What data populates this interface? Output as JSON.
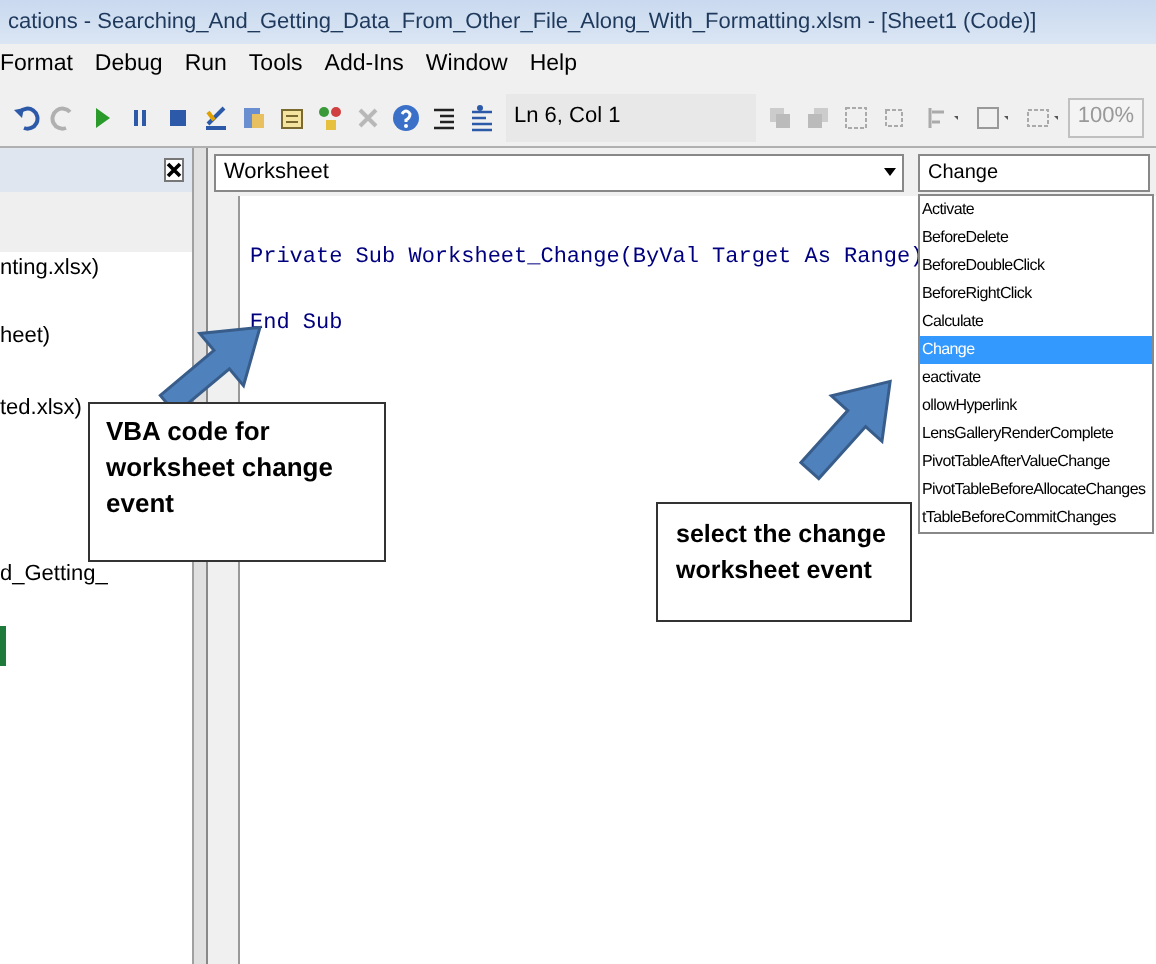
{
  "window": {
    "title": "cations - Searching_And_Getting_Data_From_Other_File_Along_With_Formatting.xlsm - [Sheet1 (Code)]"
  },
  "menu": [
    {
      "label": "Format"
    },
    {
      "label": "Debug"
    },
    {
      "label": "Run"
    },
    {
      "label": "Tools"
    },
    {
      "label": "Add-Ins"
    },
    {
      "label": "Window"
    },
    {
      "label": "Help"
    }
  ],
  "toolbar": {
    "position": "Ln 6, Col 1",
    "zoom": "100%"
  },
  "project_explorer": {
    "items": [
      "nting.xlsx)",
      "heet)",
      "ted.xlsx)",
      "d_Getting_"
    ]
  },
  "code_window": {
    "object": "Worksheet",
    "procedure": "Change",
    "code_lines": [
      "Private Sub Worksheet_Change(ByVal Target As Range)",
      "End Sub"
    ]
  },
  "procedure_list": [
    {
      "label": "Activate",
      "selected": false
    },
    {
      "label": "BeforeDelete",
      "selected": false
    },
    {
      "label": "BeforeDoubleClick",
      "selected": false
    },
    {
      "label": "BeforeRightClick",
      "selected": false
    },
    {
      "label": "Calculate",
      "selected": false
    },
    {
      "label": "Change",
      "selected": true
    },
    {
      "label": "eactivate",
      "selected": false
    },
    {
      "label": "ollowHyperlink",
      "selected": false
    },
    {
      "label": "LensGalleryRenderComplete",
      "selected": false
    },
    {
      "label": "PivotTableAfterValueChange",
      "selected": false
    },
    {
      "label": "PivotTableBeforeAllocateChanges",
      "selected": false
    },
    {
      "label": "tTableBeforeCommitChanges",
      "selected": false
    }
  ],
  "callouts": [
    {
      "text": "VBA code for worksheet change event"
    },
    {
      "text": "select the change worksheet event"
    }
  ]
}
